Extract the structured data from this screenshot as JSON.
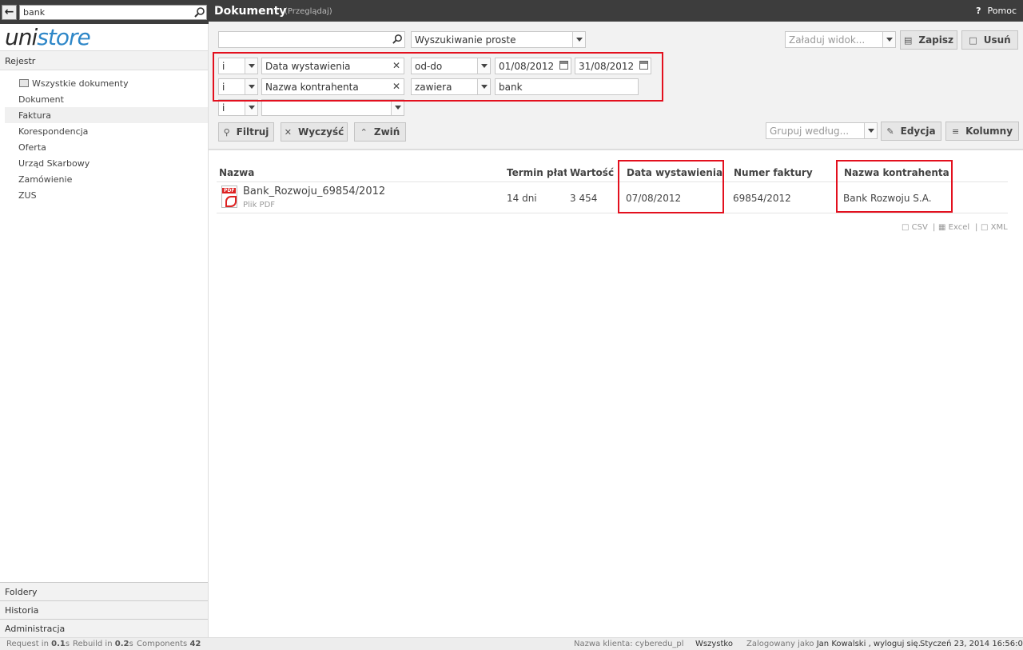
{
  "sidebar": {
    "search_value": "bank",
    "logo_part1": "uni",
    "logo_part2": "store",
    "section_title": "Rejestr",
    "all_docs": "Wszystkie dokumenty",
    "items": [
      {
        "label": "Dokument"
      },
      {
        "label": "Faktura"
      },
      {
        "label": "Korespondencja"
      },
      {
        "label": "Oferta"
      },
      {
        "label": "Urząd Skarbowy"
      },
      {
        "label": "Zamówienie"
      },
      {
        "label": "ZUS"
      }
    ],
    "active_item": "Faktura",
    "bottom": [
      "Foldery",
      "Historia",
      "Administracja"
    ]
  },
  "header": {
    "title": "Dokumenty",
    "subtitle": "(Przeglądaj)",
    "help_icon": "?",
    "help_label": "Pomoc"
  },
  "toolbar": {
    "search_value": "",
    "search_mode": "Wyszukiwanie proste",
    "load_view_placeholder": "Załaduj widok...",
    "save_label": "Zapisz",
    "delete_label": "Usuń",
    "filter_label": "Filtruj",
    "clear_label": "Wyczyść",
    "collapse_label": "Zwiń",
    "group_by_placeholder": "Grupuj według...",
    "edit_label": "Edycja",
    "columns_label": "Kolumny"
  },
  "filter_rows": [
    {
      "logic": "i",
      "field": "Data wystawienia",
      "operator": "od-do",
      "value_from": "01/08/2012",
      "value_to": "31/08/2012"
    },
    {
      "logic": "i",
      "field": "Nazwa kontrahenta",
      "operator": "zawiera",
      "value": "bank"
    },
    {
      "logic": "i",
      "field": ""
    }
  ],
  "table": {
    "columns": [
      "Nazwa",
      "Termin płatr",
      "Wartość br",
      "Data wystawienia",
      "Numer faktury",
      "Nazwa kontrahenta"
    ],
    "rows": [
      {
        "name": "Bank_Rozwoju_69854/2012",
        "type": "Plik PDF",
        "term": "14 dni",
        "value": "3 454",
        "issue_date": "07/08/2012",
        "invoice_no": "69854/2012",
        "contractor": "Bank Rozwoju S.A."
      }
    ],
    "exports": [
      "CSV",
      "Excel",
      "XML"
    ]
  },
  "statusbar": {
    "request_label": "Request in",
    "request_value": "0.1",
    "rebuild_label": "Rebuild in",
    "rebuild_value": "0.2",
    "components_label": "Components",
    "components_value": "42",
    "client": "Nazwa klienta: cyberedu_pl",
    "scope": "Wszystko",
    "logged_as": "Zalogowany jako",
    "user": "Jan Kowalski",
    "logout": ", wyloguj się.",
    "datetime": "Styczeń 23, 2014 16:56:03"
  },
  "colors": {
    "header_bg": "#3d3d3d",
    "highlight": "#e3101e",
    "logo_accent": "#2e87c8"
  }
}
